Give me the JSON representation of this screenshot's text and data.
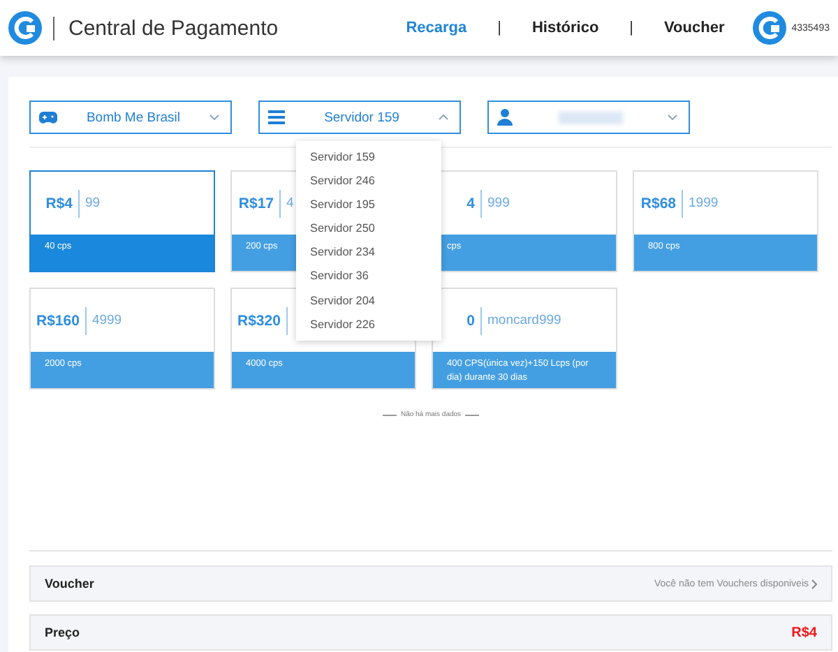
{
  "header": {
    "title": "Central de Pagamento",
    "nav": [
      {
        "label": "Recarga",
        "selected": true
      },
      {
        "label": "Histórico",
        "selected": false
      },
      {
        "label": "Voucher",
        "selected": false
      }
    ],
    "separators": [
      "|",
      "|"
    ],
    "user_id": "4335493"
  },
  "selects": [
    {
      "kind": "game",
      "value": "Bomb Me Brasil",
      "expanded": false
    },
    {
      "kind": "server",
      "value": "Servidor 159",
      "expanded": true
    },
    {
      "kind": "user",
      "expanded": false
    }
  ],
  "server_options": [
    "Servidor 159",
    "Servidor 246",
    "Servidor 195",
    "Servidor 250",
    "Servidor 234",
    "Servidor 36",
    "Servidor 204",
    "Servidor 226"
  ],
  "packages": [
    {
      "price": "R$4",
      "amount": "99",
      "description": "40 cps",
      "selected": true
    },
    {
      "price": "R$17",
      "amount": "4",
      "description": "200 cps",
      "selected": false
    },
    {
      "price": "4",
      "amount": "999",
      "description": "cps",
      "selected": false
    },
    {
      "price": "R$68",
      "amount": "1999",
      "description": "800 cps",
      "selected": false
    },
    {
      "price": "R$160",
      "amount": "4999",
      "description": "2000 cps",
      "selected": false
    },
    {
      "price": "R$320",
      "description": "4000 cps",
      "selected": false
    },
    {
      "price": "0",
      "amount": "moncard999",
      "description": "400 CPS(única vez)+150 Lcps (por dia) durante 30 dias",
      "selected": false
    }
  ],
  "end_note": "Não há mais dados",
  "voucher": {
    "label": "Voucher",
    "value": "Você não tem Vouchers disponiveis"
  },
  "price": {
    "label": "Preço",
    "value": "R$4"
  }
}
